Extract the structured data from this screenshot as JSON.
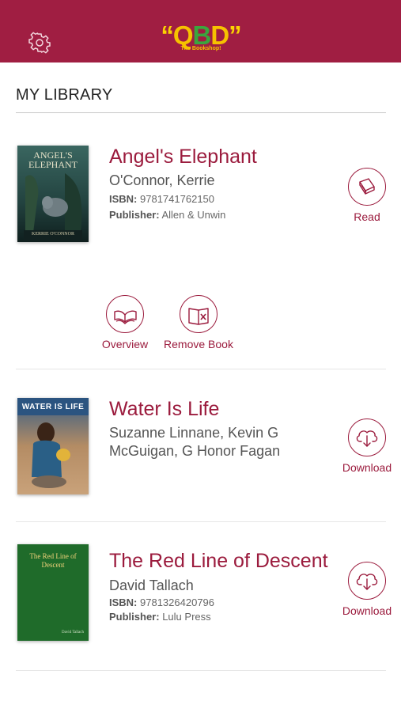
{
  "header": {
    "logo_text": "QBD",
    "logo_quote_left": "“",
    "logo_quote_right": "”",
    "logo_tagline": "The Bookshop!",
    "brand_color": "#a01e42",
    "settings_icon": "gear-icon"
  },
  "page": {
    "title": "MY LIBRARY"
  },
  "books": [
    {
      "title": "Angel's Elephant",
      "author": "O'Connor, Kerrie",
      "isbn_label": "ISBN:",
      "isbn": "9781741762150",
      "publisher_label": "Publisher:",
      "publisher": "Allen & Unwin",
      "cover_title": "ANGEL'S ELEPHANT",
      "cover_author": "KERRIE O'CONNOR",
      "action_label": "Read",
      "action_icon": "book-icon",
      "extra_actions": [
        {
          "label": "Overview",
          "icon": "open-book-icon"
        },
        {
          "label": "Remove Book",
          "icon": "remove-book-icon"
        }
      ]
    },
    {
      "title": "Water Is Life",
      "author": "Suzanne Linnane, Kevin G McGuigan, G Honor Fagan",
      "cover_title": "WATER IS LIFE",
      "action_label": "Download",
      "action_icon": "cloud-download-icon"
    },
    {
      "title": "The Red Line of Descent",
      "author": "David Tallach",
      "isbn_label": "ISBN:",
      "isbn": "9781326420796",
      "publisher_label": "Publisher:",
      "publisher": "Lulu Press",
      "cover_title": "The Red Line of Descent",
      "cover_author": "David Tallach",
      "action_label": "Download",
      "action_icon": "cloud-download-icon"
    }
  ],
  "colors": {
    "accent": "#9b1b3d",
    "logo_yellow": "#f6c200",
    "logo_green": "#3aa63d"
  }
}
